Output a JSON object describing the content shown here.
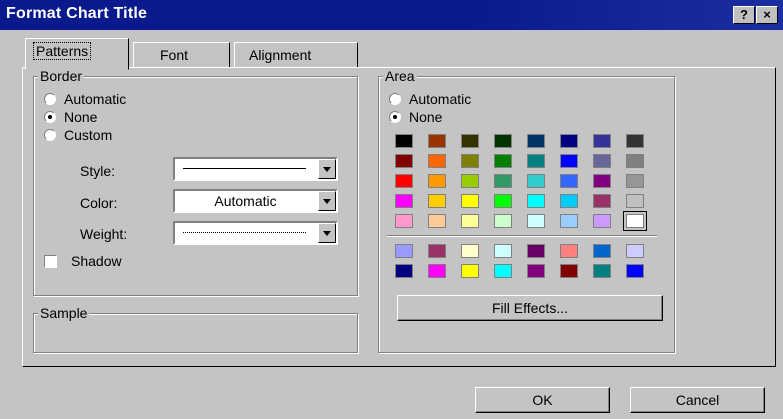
{
  "window": {
    "title": "Format Chart Title",
    "help_label": "?",
    "close_label": "×"
  },
  "tabs": [
    {
      "label": "Patterns",
      "active": true
    },
    {
      "label": "Font",
      "active": false
    },
    {
      "label": "Alignment",
      "active": false
    }
  ],
  "border": {
    "group_label": "Border",
    "options": [
      {
        "label": "Automatic",
        "selected": false
      },
      {
        "label": "None",
        "selected": true
      },
      {
        "label": "Custom",
        "selected": false
      }
    ],
    "style_label": "Style:",
    "color_label": "Color:",
    "color_value": "Automatic",
    "weight_label": "Weight:",
    "shadow_label": "Shadow",
    "shadow_checked": false
  },
  "sample": {
    "group_label": "Sample"
  },
  "area": {
    "group_label": "Area",
    "options": [
      {
        "label": "Automatic",
        "selected": false
      },
      {
        "label": "None",
        "selected": true
      }
    ],
    "palette_main": [
      [
        "#000000",
        "#993300",
        "#333300",
        "#003300",
        "#003366",
        "#000080",
        "#333399",
        "#333333"
      ],
      [
        "#800000",
        "#FF6600",
        "#808000",
        "#008000",
        "#008080",
        "#0000FF",
        "#666699",
        "#808080"
      ],
      [
        "#FF0000",
        "#FF9900",
        "#99CC00",
        "#339966",
        "#33CCCC",
        "#3366FF",
        "#800080",
        "#969696"
      ],
      [
        "#FF00FF",
        "#FFCC00",
        "#FFFF00",
        "#00FF00",
        "#00FFFF",
        "#00CCFF",
        "#993366",
        "#C0C0C0"
      ],
      [
        "#FF99CC",
        "#FFCC99",
        "#FFFF99",
        "#CCFFCC",
        "#CCFFFF",
        "#99CCFF",
        "#CC99FF",
        "#FFFFFF"
      ]
    ],
    "palette_extra": [
      [
        "#9999FF",
        "#993366",
        "#FFFFCC",
        "#CCFFFF",
        "#660066",
        "#FF8080",
        "#0066CC",
        "#CCCCFF"
      ],
      [
        "#000080",
        "#FF00FF",
        "#FFFF00",
        "#00FFFF",
        "#800080",
        "#800000",
        "#008080",
        "#0000FF"
      ]
    ],
    "fill_effects_label": "Fill Effects..."
  },
  "buttons": {
    "ok_label": "OK",
    "cancel_label": "Cancel"
  }
}
